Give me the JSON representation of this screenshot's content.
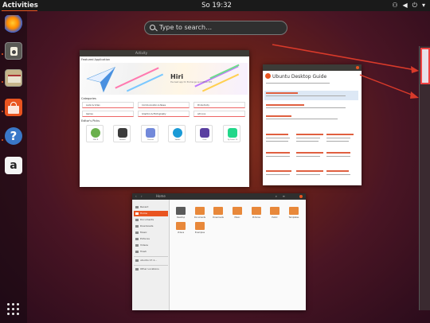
{
  "topbar": {
    "activities": "Activities",
    "clock": "So 19:32"
  },
  "search": {
    "placeholder": "Type to search…"
  },
  "software": {
    "title_center": "Activity",
    "featured_label": "Featured Application",
    "app_name": "Hiri",
    "app_sub": "the best app for Exchange and Office 365",
    "categories_label": "Categories",
    "categories": [
      "Audio & Video",
      "Communication & News",
      "Productivity",
      "Games",
      "Graphics & Photography",
      "Add-ons"
    ],
    "editors_label": "Editor's Picks",
    "picks": [
      "GNU R",
      "Bookbit",
      "Discord",
      "Sabaki",
      "Krita",
      "PyCharm CE"
    ]
  },
  "help": {
    "title": "Ubuntu Desktop Guide",
    "sections": [
      "Your Desktop",
      "Internet & Email",
      "Sound & Video",
      "Files, Folders & Search",
      "Connections",
      "Hardware & Drivers",
      "Networking, Web & Email",
      "Accessibility"
    ]
  },
  "files": {
    "title": "Home",
    "sidebar": [
      "Recent",
      "Home",
      "Documents",
      "Downloads",
      "Music",
      "Pictures",
      "Videos",
      "Trash",
      "ubuntu 17.1…",
      "Other Locations"
    ],
    "folders": [
      "Desktop",
      "Documents",
      "Downloads",
      "Music",
      "Pictures",
      "Public",
      "Templates",
      "Videos",
      "Examples"
    ]
  },
  "colors": {
    "accent": "#e95420",
    "arrow": "#d93a2a",
    "topbar": "#1a1a1a"
  }
}
